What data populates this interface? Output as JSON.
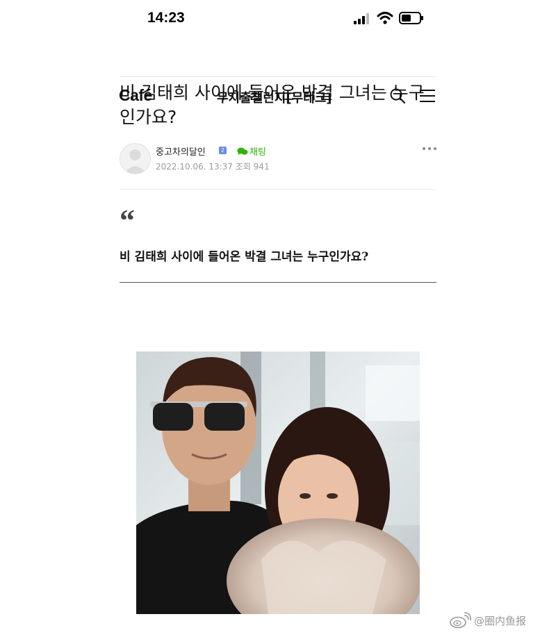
{
  "status_bar": {
    "time": "14:23"
  },
  "nav": {
    "logo": "Café",
    "cafe_name": "무지출챌린지[무테크]"
  },
  "post": {
    "title": "비 김태희 사이에 들어온 박결 그녀는 누구인가요?",
    "author": "중고차의달인",
    "author_grade": "2",
    "chat_label": "채팅",
    "date": "2022.10.06. 13:37",
    "views_label": "조회",
    "views": "941",
    "quote_mark": "“",
    "quote_text": "비 김태희 사이에 들어온 박결 그녀는 누구인가요?"
  },
  "watermark": {
    "text": "@圈内鱼报"
  },
  "colors": {
    "chat_green": "#2db400",
    "grade_blue": "#6a8ee0"
  }
}
